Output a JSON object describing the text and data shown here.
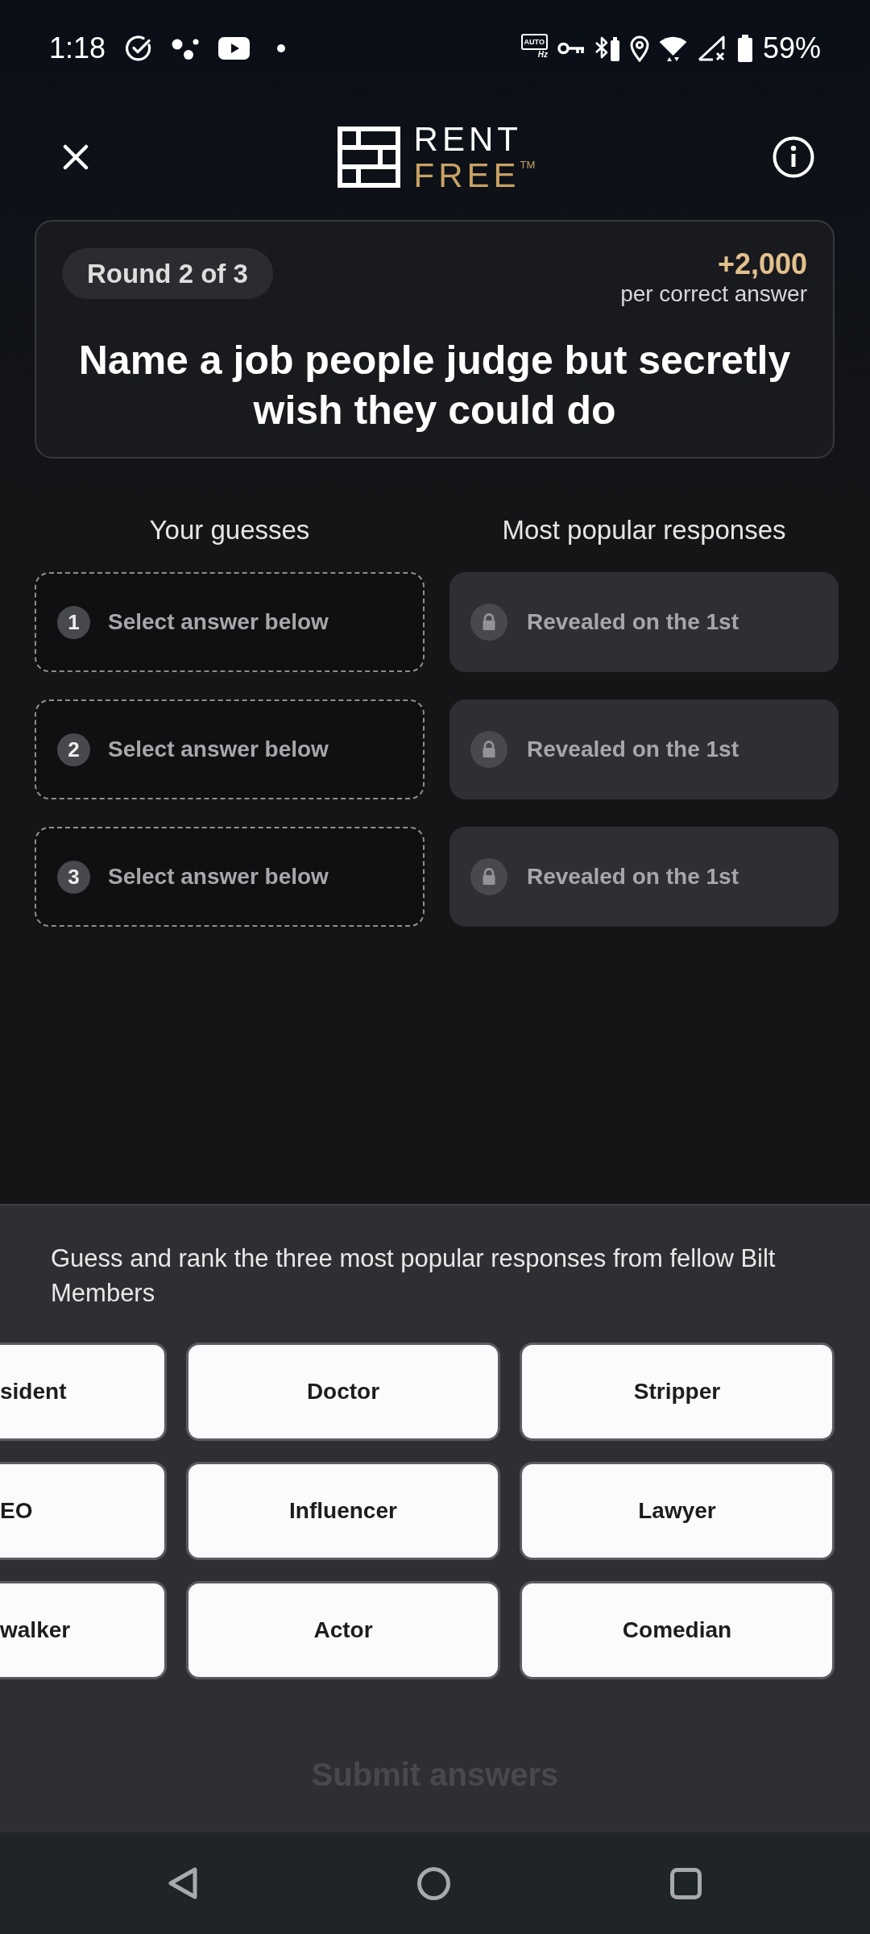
{
  "status_bar": {
    "time": "1:18",
    "refresh_rate_badge": {
      "top": "AUTO",
      "bottom": "Hz"
    },
    "battery_percent": "59%"
  },
  "header": {
    "logo": {
      "line_1": "RENT",
      "line_2": "FREE",
      "trademark": "TM"
    }
  },
  "round_card": {
    "round_label": "Round 2 of 3",
    "reward": {
      "amount": "+2,000",
      "caption": "per correct answer"
    },
    "question": "Name a job people judge but secretly wish they could do"
  },
  "guesses": {
    "heading": "Your guesses",
    "slots": [
      {
        "number": "1",
        "placeholder": "Select answer below"
      },
      {
        "number": "2",
        "placeholder": "Select answer below"
      },
      {
        "number": "3",
        "placeholder": "Select answer below"
      }
    ]
  },
  "popular_responses": {
    "heading": "Most popular responses",
    "items": [
      {
        "text": "Revealed on the 1st",
        "locked": true
      },
      {
        "text": "Revealed on the 1st",
        "locked": true
      },
      {
        "text": "Revealed on the 1st",
        "locked": true
      }
    ]
  },
  "answer_sheet": {
    "instruction": "Guess and rank the three most popular responses from fellow Bilt Members",
    "options": [
      {
        "label": "sident"
      },
      {
        "label": "Doctor"
      },
      {
        "label": "Stripper"
      },
      {
        "label": "EO"
      },
      {
        "label": "Influencer"
      },
      {
        "label": "Lawyer"
      },
      {
        "label": "walker"
      },
      {
        "label": "Actor"
      },
      {
        "label": "Comedian"
      }
    ],
    "submit": {
      "label": "Submit answers",
      "disabled": true
    }
  }
}
